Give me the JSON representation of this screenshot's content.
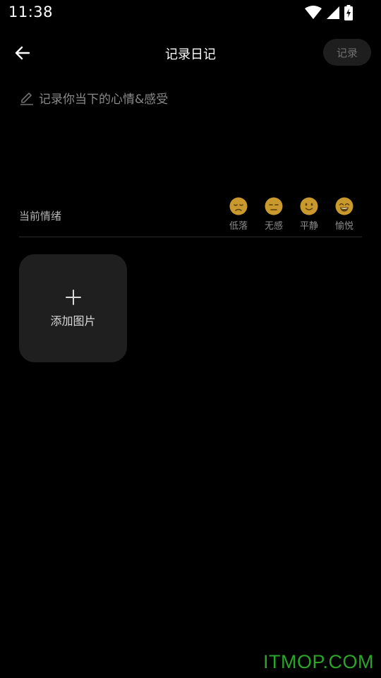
{
  "status_bar": {
    "time": "11:38",
    "icons": [
      "wifi-icon",
      "cell-signal-icon",
      "battery-charging-icon"
    ]
  },
  "header": {
    "back_icon": "arrow-left-icon",
    "title": "记录日记",
    "record_label": "记录"
  },
  "diary": {
    "icon": "pencil-icon",
    "placeholder": "记录你当下的心情&感受"
  },
  "mood": {
    "label": "当前情绪",
    "face_color": "#c9992e",
    "options": [
      {
        "label": "低落",
        "icon": "sad-face-icon"
      },
      {
        "label": "无感",
        "icon": "neutral-face-icon"
      },
      {
        "label": "平静",
        "icon": "calm-face-icon"
      },
      {
        "label": "愉悦",
        "icon": "happy-face-icon"
      }
    ]
  },
  "add_image": {
    "icon": "plus-icon",
    "label": "添加图片"
  },
  "watermark": "ITMOP.COM",
  "colors": {
    "background": "#000000",
    "card": "#1f1f1f",
    "watermark": "#2aa52a"
  }
}
